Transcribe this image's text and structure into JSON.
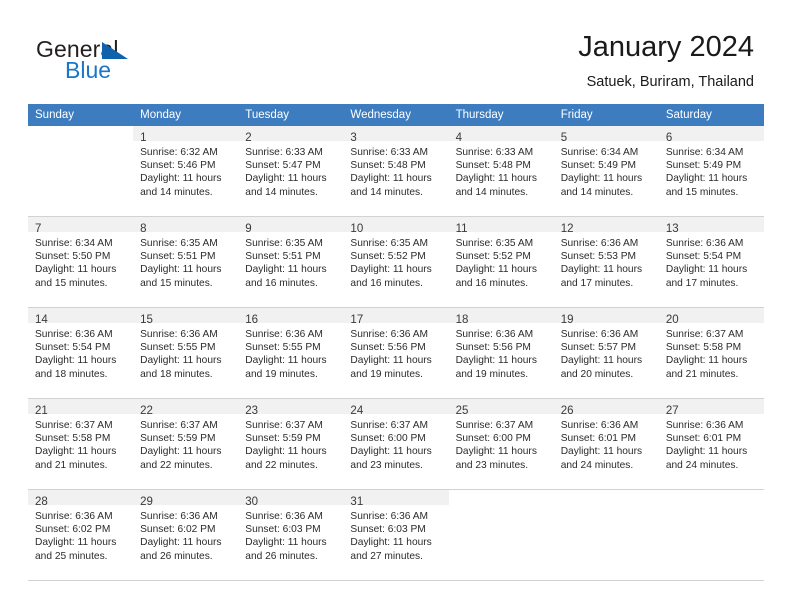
{
  "brand": {
    "name_part1": "General",
    "name_part2": "Blue",
    "accent_color": "#1a76c8",
    "triangle_color": "#0f63ad"
  },
  "header": {
    "title": "January 2024",
    "subtitle": "Satuek, Buriram, Thailand"
  },
  "theme": {
    "header_row_bg": "#3d7cbf",
    "daynum_band_bg": "#f1f1f1",
    "grid_line": "#d2d2d2",
    "text_color": "#2b2b2b"
  },
  "weekdays": [
    "Sunday",
    "Monday",
    "Tuesday",
    "Wednesday",
    "Thursday",
    "Friday",
    "Saturday"
  ],
  "labels": {
    "sunrise_prefix": "Sunrise:",
    "sunset_prefix": "Sunset:",
    "daylight_prefix": "Daylight:"
  },
  "weeks": [
    [
      {
        "empty": true
      },
      {
        "day": "1",
        "line1": "Sunrise: 6:32 AM",
        "line2": "Sunset: 5:46 PM",
        "line3": "Daylight: 11 hours",
        "line4": "and 14 minutes."
      },
      {
        "day": "2",
        "line1": "Sunrise: 6:33 AM",
        "line2": "Sunset: 5:47 PM",
        "line3": "Daylight: 11 hours",
        "line4": "and 14 minutes."
      },
      {
        "day": "3",
        "line1": "Sunrise: 6:33 AM",
        "line2": "Sunset: 5:48 PM",
        "line3": "Daylight: 11 hours",
        "line4": "and 14 minutes."
      },
      {
        "day": "4",
        "line1": "Sunrise: 6:33 AM",
        "line2": "Sunset: 5:48 PM",
        "line3": "Daylight: 11 hours",
        "line4": "and 14 minutes."
      },
      {
        "day": "5",
        "line1": "Sunrise: 6:34 AM",
        "line2": "Sunset: 5:49 PM",
        "line3": "Daylight: 11 hours",
        "line4": "and 14 minutes."
      },
      {
        "day": "6",
        "line1": "Sunrise: 6:34 AM",
        "line2": "Sunset: 5:49 PM",
        "line3": "Daylight: 11 hours",
        "line4": "and 15 minutes."
      }
    ],
    [
      {
        "day": "7",
        "line1": "Sunrise: 6:34 AM",
        "line2": "Sunset: 5:50 PM",
        "line3": "Daylight: 11 hours",
        "line4": "and 15 minutes."
      },
      {
        "day": "8",
        "line1": "Sunrise: 6:35 AM",
        "line2": "Sunset: 5:51 PM",
        "line3": "Daylight: 11 hours",
        "line4": "and 15 minutes."
      },
      {
        "day": "9",
        "line1": "Sunrise: 6:35 AM",
        "line2": "Sunset: 5:51 PM",
        "line3": "Daylight: 11 hours",
        "line4": "and 16 minutes."
      },
      {
        "day": "10",
        "line1": "Sunrise: 6:35 AM",
        "line2": "Sunset: 5:52 PM",
        "line3": "Daylight: 11 hours",
        "line4": "and 16 minutes."
      },
      {
        "day": "11",
        "line1": "Sunrise: 6:35 AM",
        "line2": "Sunset: 5:52 PM",
        "line3": "Daylight: 11 hours",
        "line4": "and 16 minutes."
      },
      {
        "day": "12",
        "line1": "Sunrise: 6:36 AM",
        "line2": "Sunset: 5:53 PM",
        "line3": "Daylight: 11 hours",
        "line4": "and 17 minutes."
      },
      {
        "day": "13",
        "line1": "Sunrise: 6:36 AM",
        "line2": "Sunset: 5:54 PM",
        "line3": "Daylight: 11 hours",
        "line4": "and 17 minutes."
      }
    ],
    [
      {
        "day": "14",
        "line1": "Sunrise: 6:36 AM",
        "line2": "Sunset: 5:54 PM",
        "line3": "Daylight: 11 hours",
        "line4": "and 18 minutes."
      },
      {
        "day": "15",
        "line1": "Sunrise: 6:36 AM",
        "line2": "Sunset: 5:55 PM",
        "line3": "Daylight: 11 hours",
        "line4": "and 18 minutes."
      },
      {
        "day": "16",
        "line1": "Sunrise: 6:36 AM",
        "line2": "Sunset: 5:55 PM",
        "line3": "Daylight: 11 hours",
        "line4": "and 19 minutes."
      },
      {
        "day": "17",
        "line1": "Sunrise: 6:36 AM",
        "line2": "Sunset: 5:56 PM",
        "line3": "Daylight: 11 hours",
        "line4": "and 19 minutes."
      },
      {
        "day": "18",
        "line1": "Sunrise: 6:36 AM",
        "line2": "Sunset: 5:56 PM",
        "line3": "Daylight: 11 hours",
        "line4": "and 19 minutes."
      },
      {
        "day": "19",
        "line1": "Sunrise: 6:36 AM",
        "line2": "Sunset: 5:57 PM",
        "line3": "Daylight: 11 hours",
        "line4": "and 20 minutes."
      },
      {
        "day": "20",
        "line1": "Sunrise: 6:37 AM",
        "line2": "Sunset: 5:58 PM",
        "line3": "Daylight: 11 hours",
        "line4": "and 21 minutes."
      }
    ],
    [
      {
        "day": "21",
        "line1": "Sunrise: 6:37 AM",
        "line2": "Sunset: 5:58 PM",
        "line3": "Daylight: 11 hours",
        "line4": "and 21 minutes."
      },
      {
        "day": "22",
        "line1": "Sunrise: 6:37 AM",
        "line2": "Sunset: 5:59 PM",
        "line3": "Daylight: 11 hours",
        "line4": "and 22 minutes."
      },
      {
        "day": "23",
        "line1": "Sunrise: 6:37 AM",
        "line2": "Sunset: 5:59 PM",
        "line3": "Daylight: 11 hours",
        "line4": "and 22 minutes."
      },
      {
        "day": "24",
        "line1": "Sunrise: 6:37 AM",
        "line2": "Sunset: 6:00 PM",
        "line3": "Daylight: 11 hours",
        "line4": "and 23 minutes."
      },
      {
        "day": "25",
        "line1": "Sunrise: 6:37 AM",
        "line2": "Sunset: 6:00 PM",
        "line3": "Daylight: 11 hours",
        "line4": "and 23 minutes."
      },
      {
        "day": "26",
        "line1": "Sunrise: 6:36 AM",
        "line2": "Sunset: 6:01 PM",
        "line3": "Daylight: 11 hours",
        "line4": "and 24 minutes."
      },
      {
        "day": "27",
        "line1": "Sunrise: 6:36 AM",
        "line2": "Sunset: 6:01 PM",
        "line3": "Daylight: 11 hours",
        "line4": "and 24 minutes."
      }
    ],
    [
      {
        "day": "28",
        "line1": "Sunrise: 6:36 AM",
        "line2": "Sunset: 6:02 PM",
        "line3": "Daylight: 11 hours",
        "line4": "and 25 minutes."
      },
      {
        "day": "29",
        "line1": "Sunrise: 6:36 AM",
        "line2": "Sunset: 6:02 PM",
        "line3": "Daylight: 11 hours",
        "line4": "and 26 minutes."
      },
      {
        "day": "30",
        "line1": "Sunrise: 6:36 AM",
        "line2": "Sunset: 6:03 PM",
        "line3": "Daylight: 11 hours",
        "line4": "and 26 minutes."
      },
      {
        "day": "31",
        "line1": "Sunrise: 6:36 AM",
        "line2": "Sunset: 6:03 PM",
        "line3": "Daylight: 11 hours",
        "line4": "and 27 minutes."
      },
      {
        "empty": true
      },
      {
        "empty": true
      },
      {
        "empty": true
      }
    ]
  ]
}
